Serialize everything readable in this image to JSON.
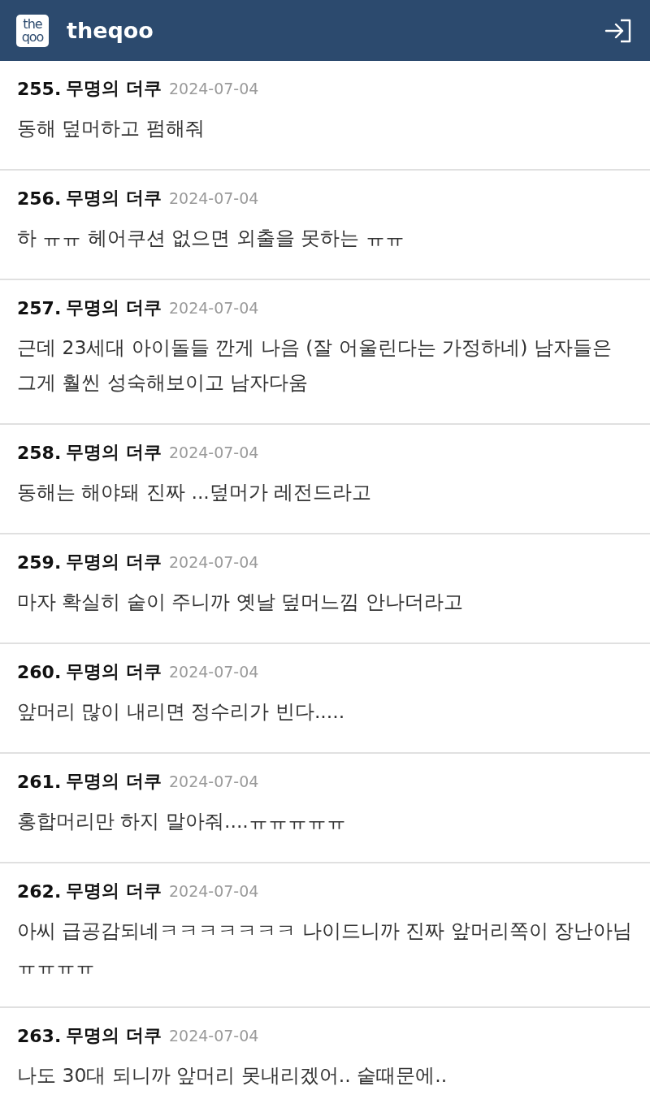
{
  "header": {
    "logo_lines": [
      "the",
      "qoo"
    ],
    "title": "theqoo"
  },
  "comments": [
    {
      "number": "255.",
      "author": "무명의 더쿠",
      "date": "2024-07-04",
      "text": "동해 덮머하고 펌해줘"
    },
    {
      "number": "256.",
      "author": "무명의 더쿠",
      "date": "2024-07-04",
      "text": "하 ㅠㅠ 헤어쿠션 없으면 외출을 못하는 ㅠㅠ"
    },
    {
      "number": "257.",
      "author": "무명의 더쿠",
      "date": "2024-07-04",
      "text": "근데 23세대 아이돌들 깐게 나음 (잘 어울린다는 가정하네) 남자들은 그게 훨씬 성숙해보이고 남자다움"
    },
    {
      "number": "258.",
      "author": "무명의 더쿠",
      "date": "2024-07-04",
      "text": "동해는 해야돼 진짜 ...덮머가 레전드라고"
    },
    {
      "number": "259.",
      "author": "무명의 더쿠",
      "date": "2024-07-04",
      "text": "마자 확실히 숱이 주니까 옛날 덮머느낌 안나더라고"
    },
    {
      "number": "260.",
      "author": "무명의 더쿠",
      "date": "2024-07-04",
      "text": "앞머리 많이 내리면 정수리가 빈다....."
    },
    {
      "number": "261.",
      "author": "무명의 더쿠",
      "date": "2024-07-04",
      "text": "홍합머리만 하지 말아줘....ㅠㅠㅠㅠㅠ"
    },
    {
      "number": "262.",
      "author": "무명의 더쿠",
      "date": "2024-07-04",
      "text": "아씨 급공감되네ㅋㅋㅋㅋㅋㅋㅋ 나이드니까 진짜 앞머리쪽이 장난아님ㅠㅠㅠㅠ"
    },
    {
      "number": "263.",
      "author": "무명의 더쿠",
      "date": "2024-07-04",
      "text": "나도 30대 되니까 앞머리 못내리겠어.. 숱때문에.."
    }
  ]
}
